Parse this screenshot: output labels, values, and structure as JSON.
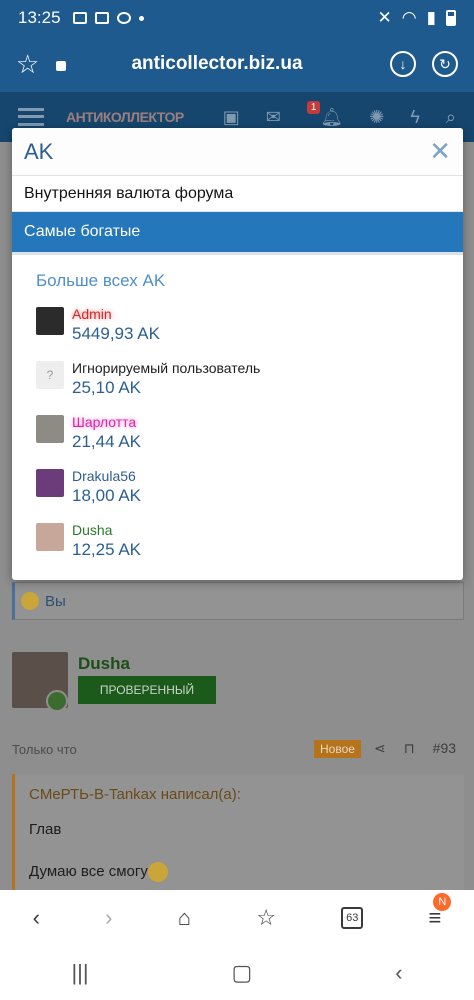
{
  "status_bar": {
    "time": "13:25"
  },
  "url_bar": {
    "url": "anticollector.biz.ua"
  },
  "site_header": {
    "logo": "АНТИКОЛЛЕКТОР",
    "alert_count": "1"
  },
  "popup": {
    "title": "AK",
    "subtitle": "Внутренняя валюта форума",
    "tab_label": "Самые богатые",
    "section_title": "Больше всех AK",
    "users": [
      {
        "name": "Admin",
        "amount": "5449,93 AK"
      },
      {
        "name": "Игнорируемый пользователь",
        "amount": "25,10 AK"
      },
      {
        "name": "Шарлотта",
        "amount": "21,44 AK"
      },
      {
        "name": "Drakula56",
        "amount": "18,00 AK"
      },
      {
        "name": "Dusha",
        "amount": "12,25 AK"
      }
    ]
  },
  "background": {
    "reaction_text": "Вы",
    "post": {
      "author": "Dusha",
      "badge": "ПРОВЕРЕННЫЙ",
      "time": "Только что",
      "new_label": "Новое",
      "post_number": "#93",
      "quote_author": "CMeРТЬ-В-Tankax написал(а):",
      "quote_text": "Глав",
      "reply_text": "Думаю все смогу"
    }
  },
  "browser_nav": {
    "tabs_count": "63",
    "menu_badge": "N"
  },
  "colors": {
    "primary": "#2577bb",
    "header": "#1f5a8e",
    "amount": "#2b5f92"
  }
}
